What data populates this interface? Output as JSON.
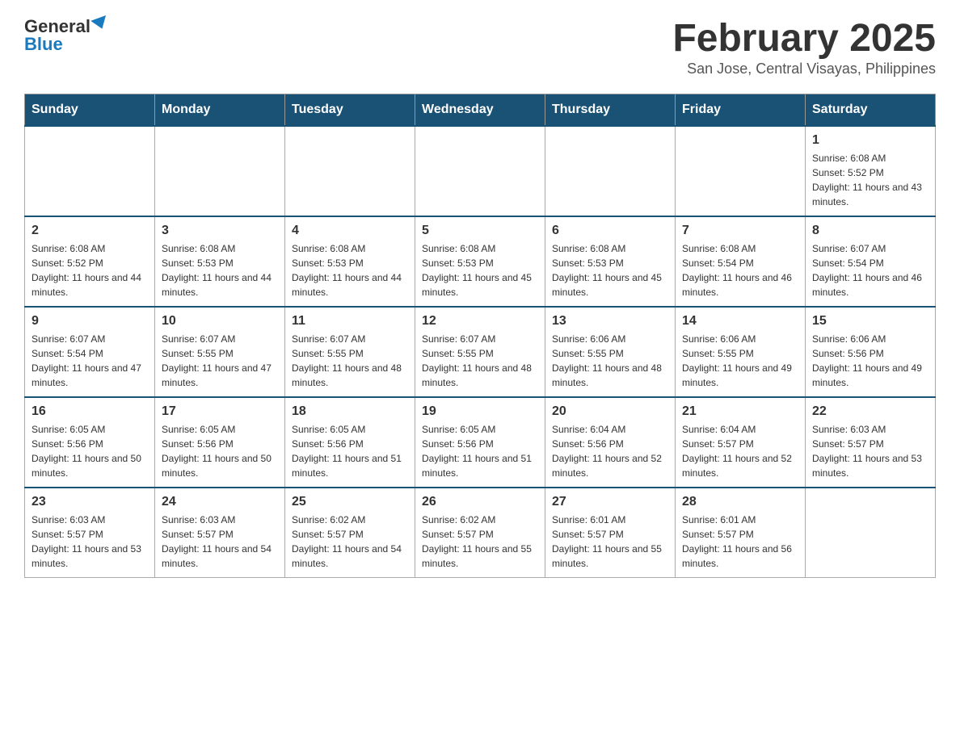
{
  "header": {
    "logo": {
      "general": "General",
      "blue": "Blue"
    },
    "title": "February 2025",
    "subtitle": "San Jose, Central Visayas, Philippines"
  },
  "weekdays": [
    "Sunday",
    "Monday",
    "Tuesday",
    "Wednesday",
    "Thursday",
    "Friday",
    "Saturday"
  ],
  "weeks": [
    [
      {
        "day": "",
        "info": ""
      },
      {
        "day": "",
        "info": ""
      },
      {
        "day": "",
        "info": ""
      },
      {
        "day": "",
        "info": ""
      },
      {
        "day": "",
        "info": ""
      },
      {
        "day": "",
        "info": ""
      },
      {
        "day": "1",
        "info": "Sunrise: 6:08 AM\nSunset: 5:52 PM\nDaylight: 11 hours and 43 minutes."
      }
    ],
    [
      {
        "day": "2",
        "info": "Sunrise: 6:08 AM\nSunset: 5:52 PM\nDaylight: 11 hours and 44 minutes."
      },
      {
        "day": "3",
        "info": "Sunrise: 6:08 AM\nSunset: 5:53 PM\nDaylight: 11 hours and 44 minutes."
      },
      {
        "day": "4",
        "info": "Sunrise: 6:08 AM\nSunset: 5:53 PM\nDaylight: 11 hours and 44 minutes."
      },
      {
        "day": "5",
        "info": "Sunrise: 6:08 AM\nSunset: 5:53 PM\nDaylight: 11 hours and 45 minutes."
      },
      {
        "day": "6",
        "info": "Sunrise: 6:08 AM\nSunset: 5:53 PM\nDaylight: 11 hours and 45 minutes."
      },
      {
        "day": "7",
        "info": "Sunrise: 6:08 AM\nSunset: 5:54 PM\nDaylight: 11 hours and 46 minutes."
      },
      {
        "day": "8",
        "info": "Sunrise: 6:07 AM\nSunset: 5:54 PM\nDaylight: 11 hours and 46 minutes."
      }
    ],
    [
      {
        "day": "9",
        "info": "Sunrise: 6:07 AM\nSunset: 5:54 PM\nDaylight: 11 hours and 47 minutes."
      },
      {
        "day": "10",
        "info": "Sunrise: 6:07 AM\nSunset: 5:55 PM\nDaylight: 11 hours and 47 minutes."
      },
      {
        "day": "11",
        "info": "Sunrise: 6:07 AM\nSunset: 5:55 PM\nDaylight: 11 hours and 48 minutes."
      },
      {
        "day": "12",
        "info": "Sunrise: 6:07 AM\nSunset: 5:55 PM\nDaylight: 11 hours and 48 minutes."
      },
      {
        "day": "13",
        "info": "Sunrise: 6:06 AM\nSunset: 5:55 PM\nDaylight: 11 hours and 48 minutes."
      },
      {
        "day": "14",
        "info": "Sunrise: 6:06 AM\nSunset: 5:55 PM\nDaylight: 11 hours and 49 minutes."
      },
      {
        "day": "15",
        "info": "Sunrise: 6:06 AM\nSunset: 5:56 PM\nDaylight: 11 hours and 49 minutes."
      }
    ],
    [
      {
        "day": "16",
        "info": "Sunrise: 6:05 AM\nSunset: 5:56 PM\nDaylight: 11 hours and 50 minutes."
      },
      {
        "day": "17",
        "info": "Sunrise: 6:05 AM\nSunset: 5:56 PM\nDaylight: 11 hours and 50 minutes."
      },
      {
        "day": "18",
        "info": "Sunrise: 6:05 AM\nSunset: 5:56 PM\nDaylight: 11 hours and 51 minutes."
      },
      {
        "day": "19",
        "info": "Sunrise: 6:05 AM\nSunset: 5:56 PM\nDaylight: 11 hours and 51 minutes."
      },
      {
        "day": "20",
        "info": "Sunrise: 6:04 AM\nSunset: 5:56 PM\nDaylight: 11 hours and 52 minutes."
      },
      {
        "day": "21",
        "info": "Sunrise: 6:04 AM\nSunset: 5:57 PM\nDaylight: 11 hours and 52 minutes."
      },
      {
        "day": "22",
        "info": "Sunrise: 6:03 AM\nSunset: 5:57 PM\nDaylight: 11 hours and 53 minutes."
      }
    ],
    [
      {
        "day": "23",
        "info": "Sunrise: 6:03 AM\nSunset: 5:57 PM\nDaylight: 11 hours and 53 minutes."
      },
      {
        "day": "24",
        "info": "Sunrise: 6:03 AM\nSunset: 5:57 PM\nDaylight: 11 hours and 54 minutes."
      },
      {
        "day": "25",
        "info": "Sunrise: 6:02 AM\nSunset: 5:57 PM\nDaylight: 11 hours and 54 minutes."
      },
      {
        "day": "26",
        "info": "Sunrise: 6:02 AM\nSunset: 5:57 PM\nDaylight: 11 hours and 55 minutes."
      },
      {
        "day": "27",
        "info": "Sunrise: 6:01 AM\nSunset: 5:57 PM\nDaylight: 11 hours and 55 minutes."
      },
      {
        "day": "28",
        "info": "Sunrise: 6:01 AM\nSunset: 5:57 PM\nDaylight: 11 hours and 56 minutes."
      },
      {
        "day": "",
        "info": ""
      }
    ]
  ]
}
